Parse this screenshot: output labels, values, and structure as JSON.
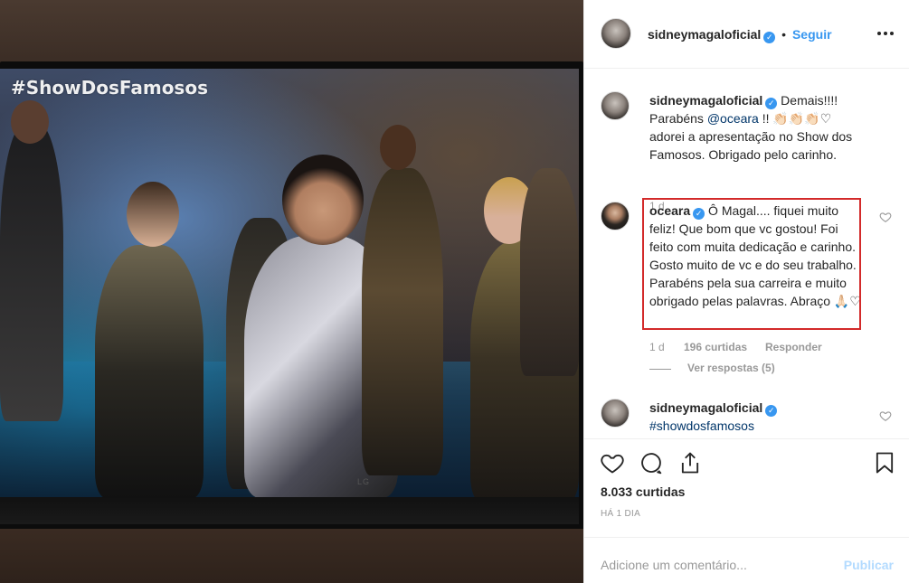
{
  "post": {
    "username": "sidneymagaloficial",
    "separator": "•",
    "follow_label": "Seguir",
    "more_icon": "more-horizontal-icon",
    "photo_overlay_text": "#ShowDosFamosos",
    "tv_brand": "LG"
  },
  "comments": [
    {
      "username": "sidneymagaloficial",
      "text_before": "Demais!!!! Parabéns ",
      "mention": "@oceara",
      "text_after": " !! 👏🏻👏🏻👏🏻♡ adorei a apresentação no Show dos Famosos. Obrigado pelo carinho.",
      "age": "1 d"
    },
    {
      "username": "oceara",
      "text": "Ô Magal.... fiquei muito feliz! Que bom que vc gostou! Foi feito com muita dedicação e carinho. Gosto muito de vc e do seu trabalho. Parabéns pela sua carreira e muito obrigado pelas palavras. Abraço 🙏🏻♡",
      "age": "1 d",
      "likes": "196 curtidas",
      "reply_label": "Responder",
      "view_replies": "Ver respostas (5)"
    },
    {
      "username": "sidneymagaloficial",
      "hashtag": "#showdosfamosos"
    }
  ],
  "actions": {
    "likes": "8.033 curtidas",
    "time": "HÁ 1 DIA",
    "comment_placeholder": "Adicione um comentário...",
    "publish_label": "Publicar"
  },
  "colors": {
    "accent": "#3897f0",
    "highlight_border": "#d32a2a",
    "mention": "#003569"
  }
}
